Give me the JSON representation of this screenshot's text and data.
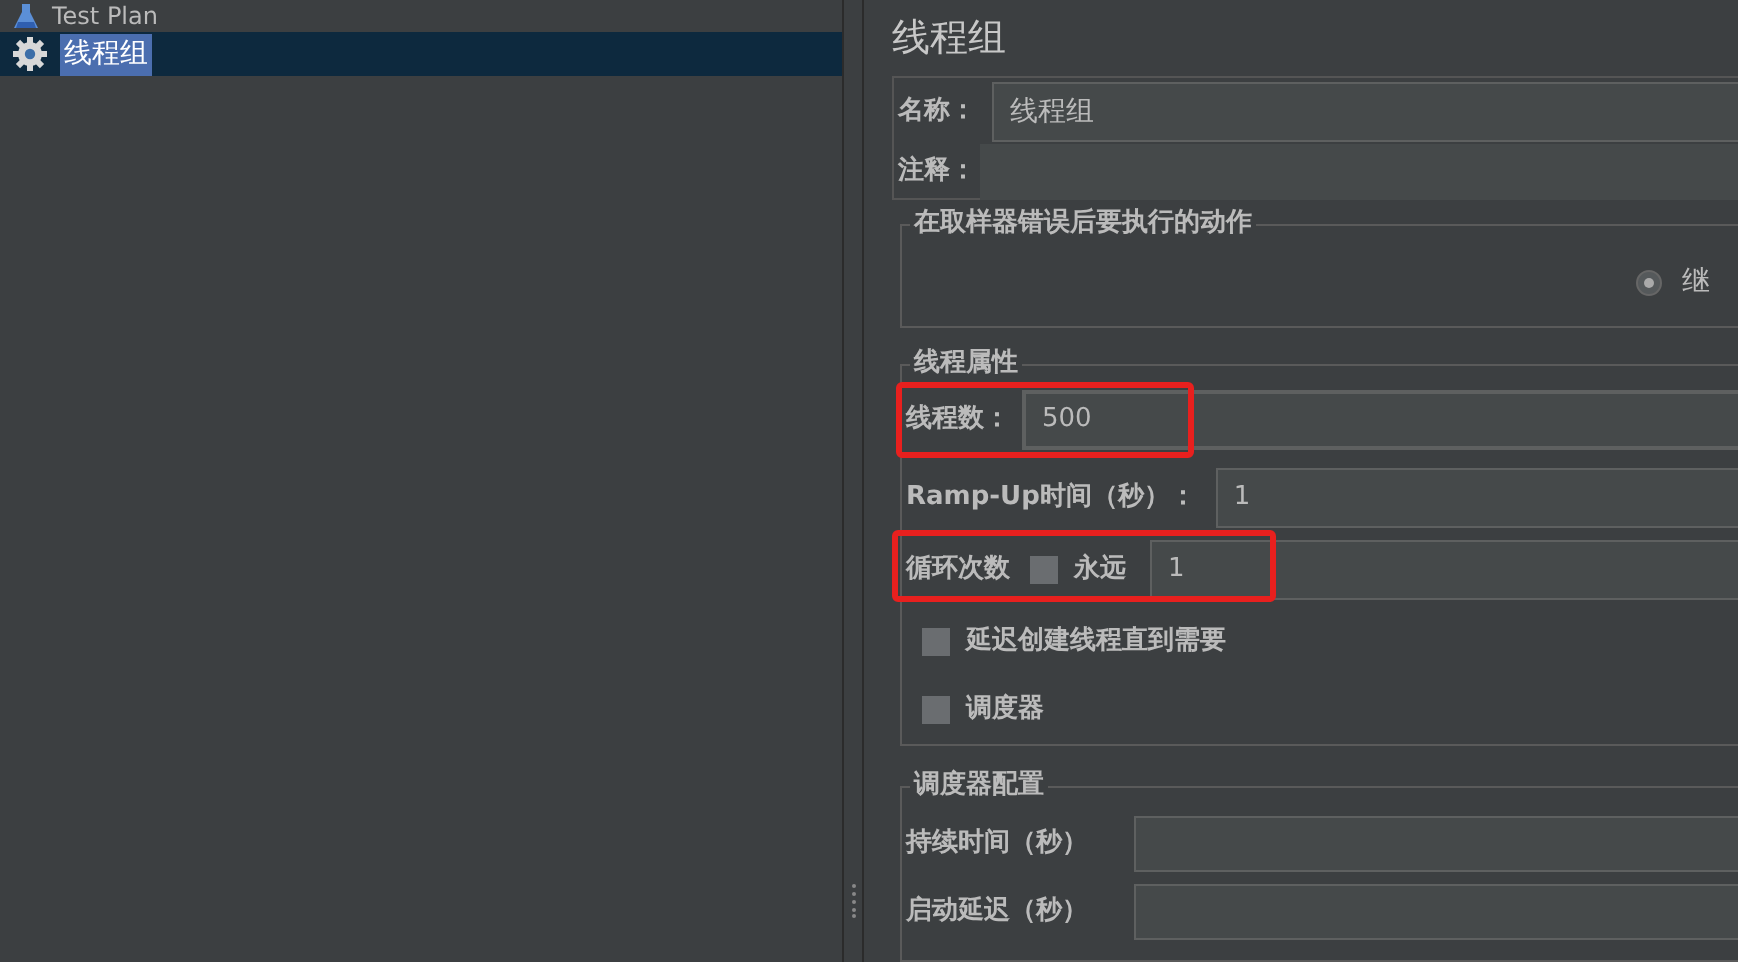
{
  "tree": {
    "items": [
      {
        "label": "Test Plan",
        "selected": false
      },
      {
        "label": "线程组",
        "selected": true
      }
    ]
  },
  "panel": {
    "title": "线程组",
    "name": {
      "label": "名称：",
      "value": "线程组"
    },
    "comment": {
      "label": "注释："
    },
    "error_action": {
      "legend": "在取样器错误后要执行的动作",
      "option": {
        "label": "继",
        "selected": true
      }
    },
    "thread_properties": {
      "legend": "线程属性",
      "thread_count": {
        "label": "线程数：",
        "value": "500",
        "focused": true,
        "highlighted": true
      },
      "ramp_up": {
        "label": "Ramp-Up时间（秒）：",
        "value": "1"
      },
      "loop_count": {
        "label": "循环次数",
        "forever_label": "永远",
        "forever_checked": false,
        "value": "1",
        "highlighted": true
      },
      "checkboxes": [
        {
          "label": "延迟创建线程直到需要",
          "checked": false
        },
        {
          "label": "调度器",
          "checked": false
        }
      ]
    },
    "scheduler": {
      "legend": "调度器配置",
      "fields": [
        {
          "label": "持续时间（秒）"
        },
        {
          "label": "启动延迟（秒）"
        }
      ]
    }
  }
}
